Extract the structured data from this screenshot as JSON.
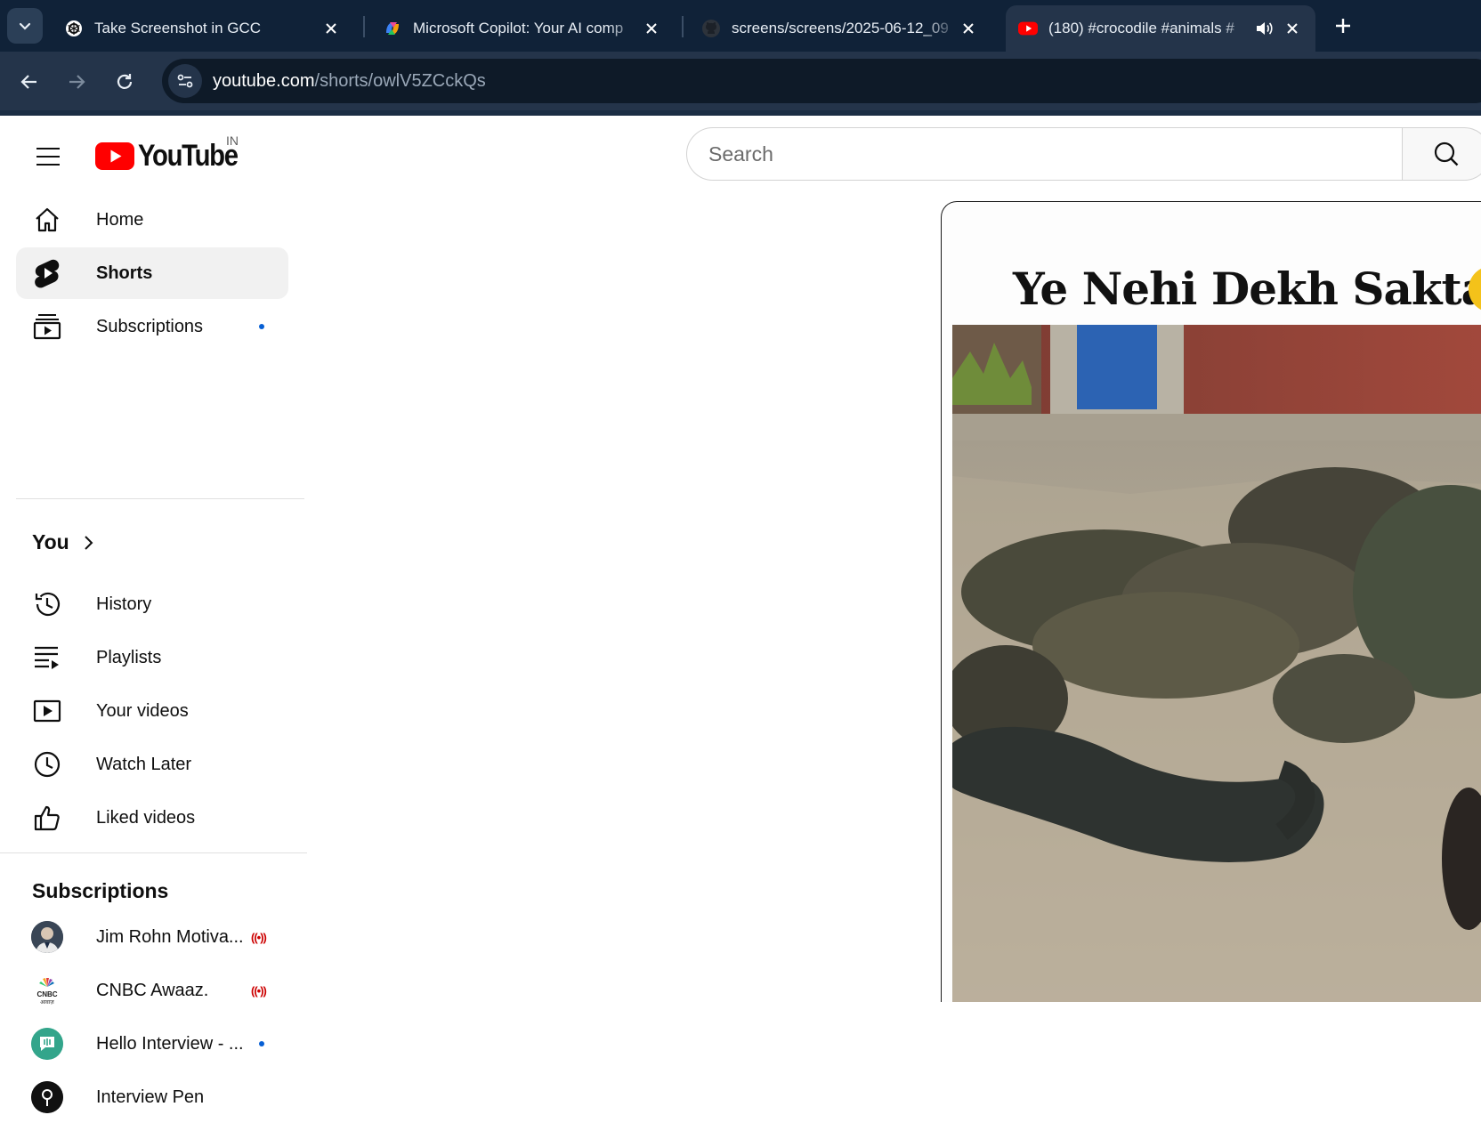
{
  "browser": {
    "tabs": [
      {
        "title": "Take Screenshot in GCC",
        "favicon": "chatgpt-icon",
        "active": false
      },
      {
        "title": "Microsoft Copilot: Your AI comp",
        "favicon": "copilot-icon",
        "active": false
      },
      {
        "title": "screens/screens/2025-06-12_09",
        "favicon": "github-icon",
        "active": false
      },
      {
        "title": "(180) #crocodile #animals #",
        "favicon": "youtube-icon",
        "active": true,
        "audio": true
      }
    ],
    "url_host": "youtube.com",
    "url_path": "/shorts/owlV5ZCckQs"
  },
  "youtube": {
    "logo_text": "YouTube",
    "country_code": "IN",
    "search_placeholder": "Search",
    "nav": [
      {
        "label": "Home",
        "icon": "home-icon"
      },
      {
        "label": "Shorts",
        "icon": "shorts-icon",
        "selected": true
      },
      {
        "label": "Subscriptions",
        "icon": "subscriptions-icon",
        "new_dot": true
      }
    ],
    "you_section": {
      "title": "You",
      "items": [
        {
          "label": "History",
          "icon": "history-icon"
        },
        {
          "label": "Playlists",
          "icon": "playlists-icon"
        },
        {
          "label": "Your videos",
          "icon": "your-videos-icon"
        },
        {
          "label": "Watch Later",
          "icon": "watch-later-icon"
        },
        {
          "label": "Liked videos",
          "icon": "liked-videos-icon"
        }
      ]
    },
    "subscriptions_section": {
      "title": "Subscriptions",
      "channels": [
        {
          "name": "Jim Rohn Motiva...",
          "status": "live"
        },
        {
          "name": "CNBC Awaaz.",
          "status": "live"
        },
        {
          "name": "Hello Interview - ...",
          "status": "new"
        },
        {
          "name": "Interview Pen",
          "status": "none"
        }
      ]
    },
    "short": {
      "caption": "Ye Nehi Dekh Sakta"
    }
  },
  "colors": {
    "tabstrip": "#102238",
    "toolbar": "#24344a",
    "youtube_red": "#ff0000",
    "blue_dot": "#065fd4"
  }
}
